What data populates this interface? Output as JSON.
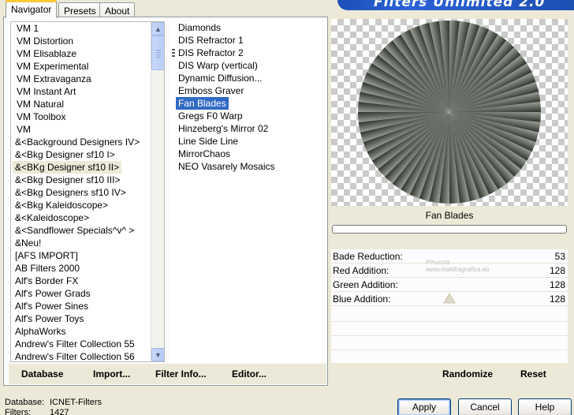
{
  "banner": {
    "title": "Filters Unlimited 2.0"
  },
  "tabs": [
    {
      "label": "Navigator",
      "active": true
    },
    {
      "label": "Presets",
      "active": false
    },
    {
      "label": "About",
      "active": false
    }
  ],
  "categories": {
    "items": [
      "VM 1",
      "VM Distortion",
      "VM Elisablaze",
      "VM Experimental",
      "VM Extravaganza",
      "VM Instant Art",
      "VM Natural",
      "VM Toolbox",
      "VM",
      "&<Background Designers IV>",
      "&<Bkg Designer sf10 I>",
      "&<BKg Designer sf10 II>",
      "&<Bkg Designer sf10 III>",
      "&<Bkg Designers sf10 IV>",
      "&<Bkg Kaleidoscope>",
      "&<Kaleidoscope>",
      "&<Sandflower Specials^v^ >",
      "&Neu!",
      "[AFS IMPORT]",
      "AB Filters 2000",
      "Alf's Border FX",
      "Alf's Power Grads",
      "Alf's Power Sines",
      "Alf's Power Toys",
      "AlphaWorks",
      "Andrew's Filter Collection 55",
      "Andrew's Filter Collection 56"
    ],
    "selected_index": 11
  },
  "filters": {
    "items": [
      "Diamonds",
      "DIS Refractor 1",
      "DIS Refractor 2",
      "DIS Warp (vertical)",
      "Dynamic Diffusion...",
      "Emboss Graver",
      "Fan Blades",
      "Gregs F0 Warp",
      "Hinzeberg's Mirror 02",
      "Line Side Line",
      "MirrorChaos",
      "NEO Vasarely Mosaics"
    ],
    "selected_index": 6
  },
  "left_buttons": {
    "database": "Database",
    "import": "Import...",
    "filter_info": "Filter Info...",
    "editor": "Editor..."
  },
  "preview": {
    "filter_name": "Fan Blades",
    "progress": 0
  },
  "params": [
    {
      "label": "Bade Reduction:",
      "value": "53"
    },
    {
      "label": "Red Addition:",
      "value": "128"
    },
    {
      "label": "Green Addition:",
      "value": "128"
    },
    {
      "label": "Blue Addition:",
      "value": "128"
    }
  ],
  "right_buttons": {
    "randomize": "Randomize",
    "reset": "Reset"
  },
  "footer": {
    "database_label": "Database:",
    "database_value": "ICNET-Filters",
    "filters_label": "Filters:",
    "filters_value": "1427"
  },
  "dialog_buttons": {
    "apply": "Apply",
    "cancel": "Cancel",
    "help": "Help"
  },
  "watermark": "Pinuccia www.maldiragrafica.eu",
  "colors": {
    "selection": "#316ac5",
    "banner": "#2a63d6",
    "fan_dark": "#2e332d",
    "fan_light": "#9aa096"
  }
}
